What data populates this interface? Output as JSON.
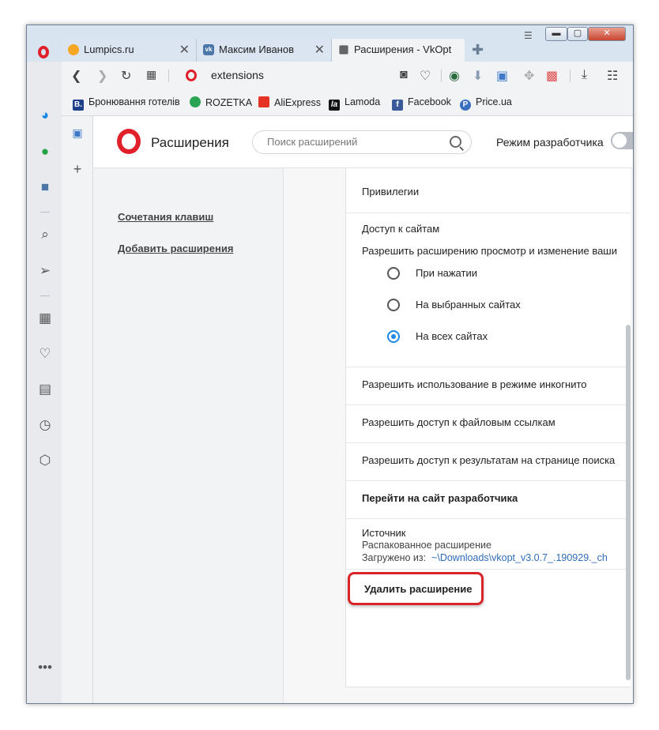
{
  "tabs": [
    {
      "label": "Lumpics.ru",
      "favicon_color": "#f5a623"
    },
    {
      "label": "Максим Иванов",
      "favicon_color": "#4a76a8"
    },
    {
      "label": "Расширения - VkOpt",
      "favicon_color": "#666666"
    }
  ],
  "address": {
    "url": "extensions"
  },
  "bookmarks": [
    {
      "label": "Бронювання готелів",
      "icon_text": "B.",
      "icon_color": "#1e3f8a"
    },
    {
      "label": "ROZETKA",
      "icon_text": "",
      "icon_color": "#2aa353"
    },
    {
      "label": "AliExpress",
      "icon_text": "",
      "icon_color": "#e43225"
    },
    {
      "label": "Lamoda",
      "icon_text": "la",
      "icon_color": "#111111"
    },
    {
      "label": "Facebook",
      "icon_text": "f",
      "icon_color": "#3b5998"
    },
    {
      "label": "Price.ua",
      "icon_text": "P",
      "icon_color": "#3a6ebf"
    }
  ],
  "header": {
    "title": "Расширения",
    "search_placeholder": "Поиск расширений",
    "dev_mode_label": "Режим разработчика"
  },
  "leftnav": {
    "shortcuts": "Сочетания клавиш",
    "add": "Добавить расширения"
  },
  "details": {
    "privileges": "Привилегии",
    "site_access_title": "Доступ к сайтам",
    "site_access_desc": "Разрешить расширению просмотр и изменение ваши",
    "radios": [
      "При нажатии",
      "На выбранных сайтах",
      "На всех сайтах"
    ],
    "selected_radio": 2,
    "incognito": "Разрешить использование в режиме инкогнито",
    "file_urls": "Разрешить доступ к файловым ссылкам",
    "search_results": "Разрешить доступ к результатам на странице поиска",
    "dev_site": "Перейти на сайт разработчика",
    "source_title": "Источник",
    "source_type": "Распакованное расширение",
    "loaded_from_label": "Загружено из:",
    "loaded_from_path": "~\\Downloads\\vkopt_v3.0.7_.190929._ch",
    "remove": "Удалить расширение"
  },
  "colors": {
    "opera_red": "#e0202b",
    "link_blue": "#2e6cb8",
    "highlight": "#d9252a",
    "radio_on": "#1e88e5"
  }
}
